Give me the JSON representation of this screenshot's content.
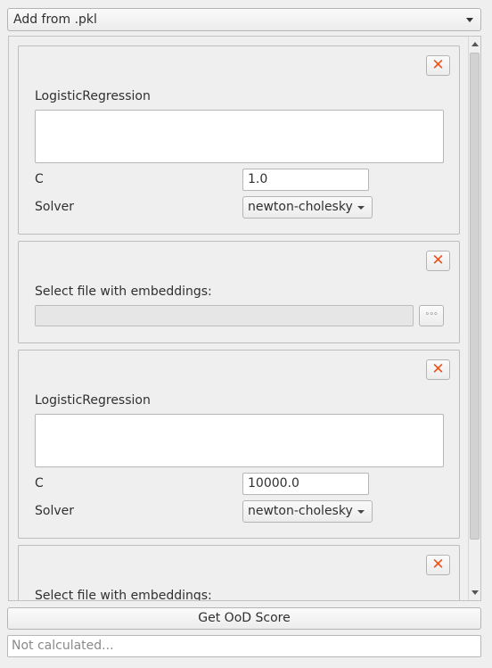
{
  "source_combo": {
    "value": "Add from .pkl"
  },
  "panels": [
    {
      "kind": "model",
      "title": "LogisticRegression",
      "close_icon": "close-icon",
      "params": {
        "c_label": "C",
        "c_value": "1.0",
        "solver_label": "Solver",
        "solver_value": "newton-cholesky"
      }
    },
    {
      "kind": "embeddings",
      "title": "Select file with embeddings:",
      "close_icon": "close-icon",
      "browse_label": "◦◦◦"
    },
    {
      "kind": "model",
      "title": "LogisticRegression",
      "close_icon": "close-icon",
      "params": {
        "c_label": "C",
        "c_value": "10000.0",
        "solver_label": "Solver",
        "solver_value": "newton-cholesky"
      }
    },
    {
      "kind": "embeddings",
      "title": "Select file with embeddings:",
      "close_icon": "close-icon"
    }
  ],
  "actions": {
    "score_button": "Get OoD Score"
  },
  "result": {
    "placeholder": "Not calculated..."
  },
  "colors": {
    "close_icon": "#e95420",
    "background": "#efefef"
  }
}
